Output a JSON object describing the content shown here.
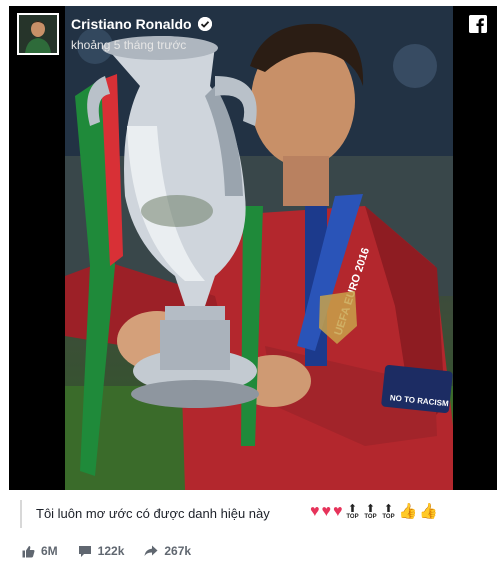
{
  "post": {
    "author_name": "Cristiano Ronaldo",
    "timestamp": "khoảng 5 tháng trước",
    "caption": "Tôi luôn mơ ước có được danh hiệu này",
    "top_label": "TOP",
    "icons": [
      "verified-badge-icon",
      "facebook-icon",
      "like-icon",
      "comment-icon",
      "share-icon"
    ]
  },
  "image": {
    "sash_text": "UEFA EURO 2016",
    "armband_text": "NO TO RACISM"
  },
  "stats": {
    "likes": "6M",
    "comments": "122k",
    "shares": "267k"
  },
  "colors": {
    "brand": "#3b5998",
    "heart": "#e6335a"
  }
}
